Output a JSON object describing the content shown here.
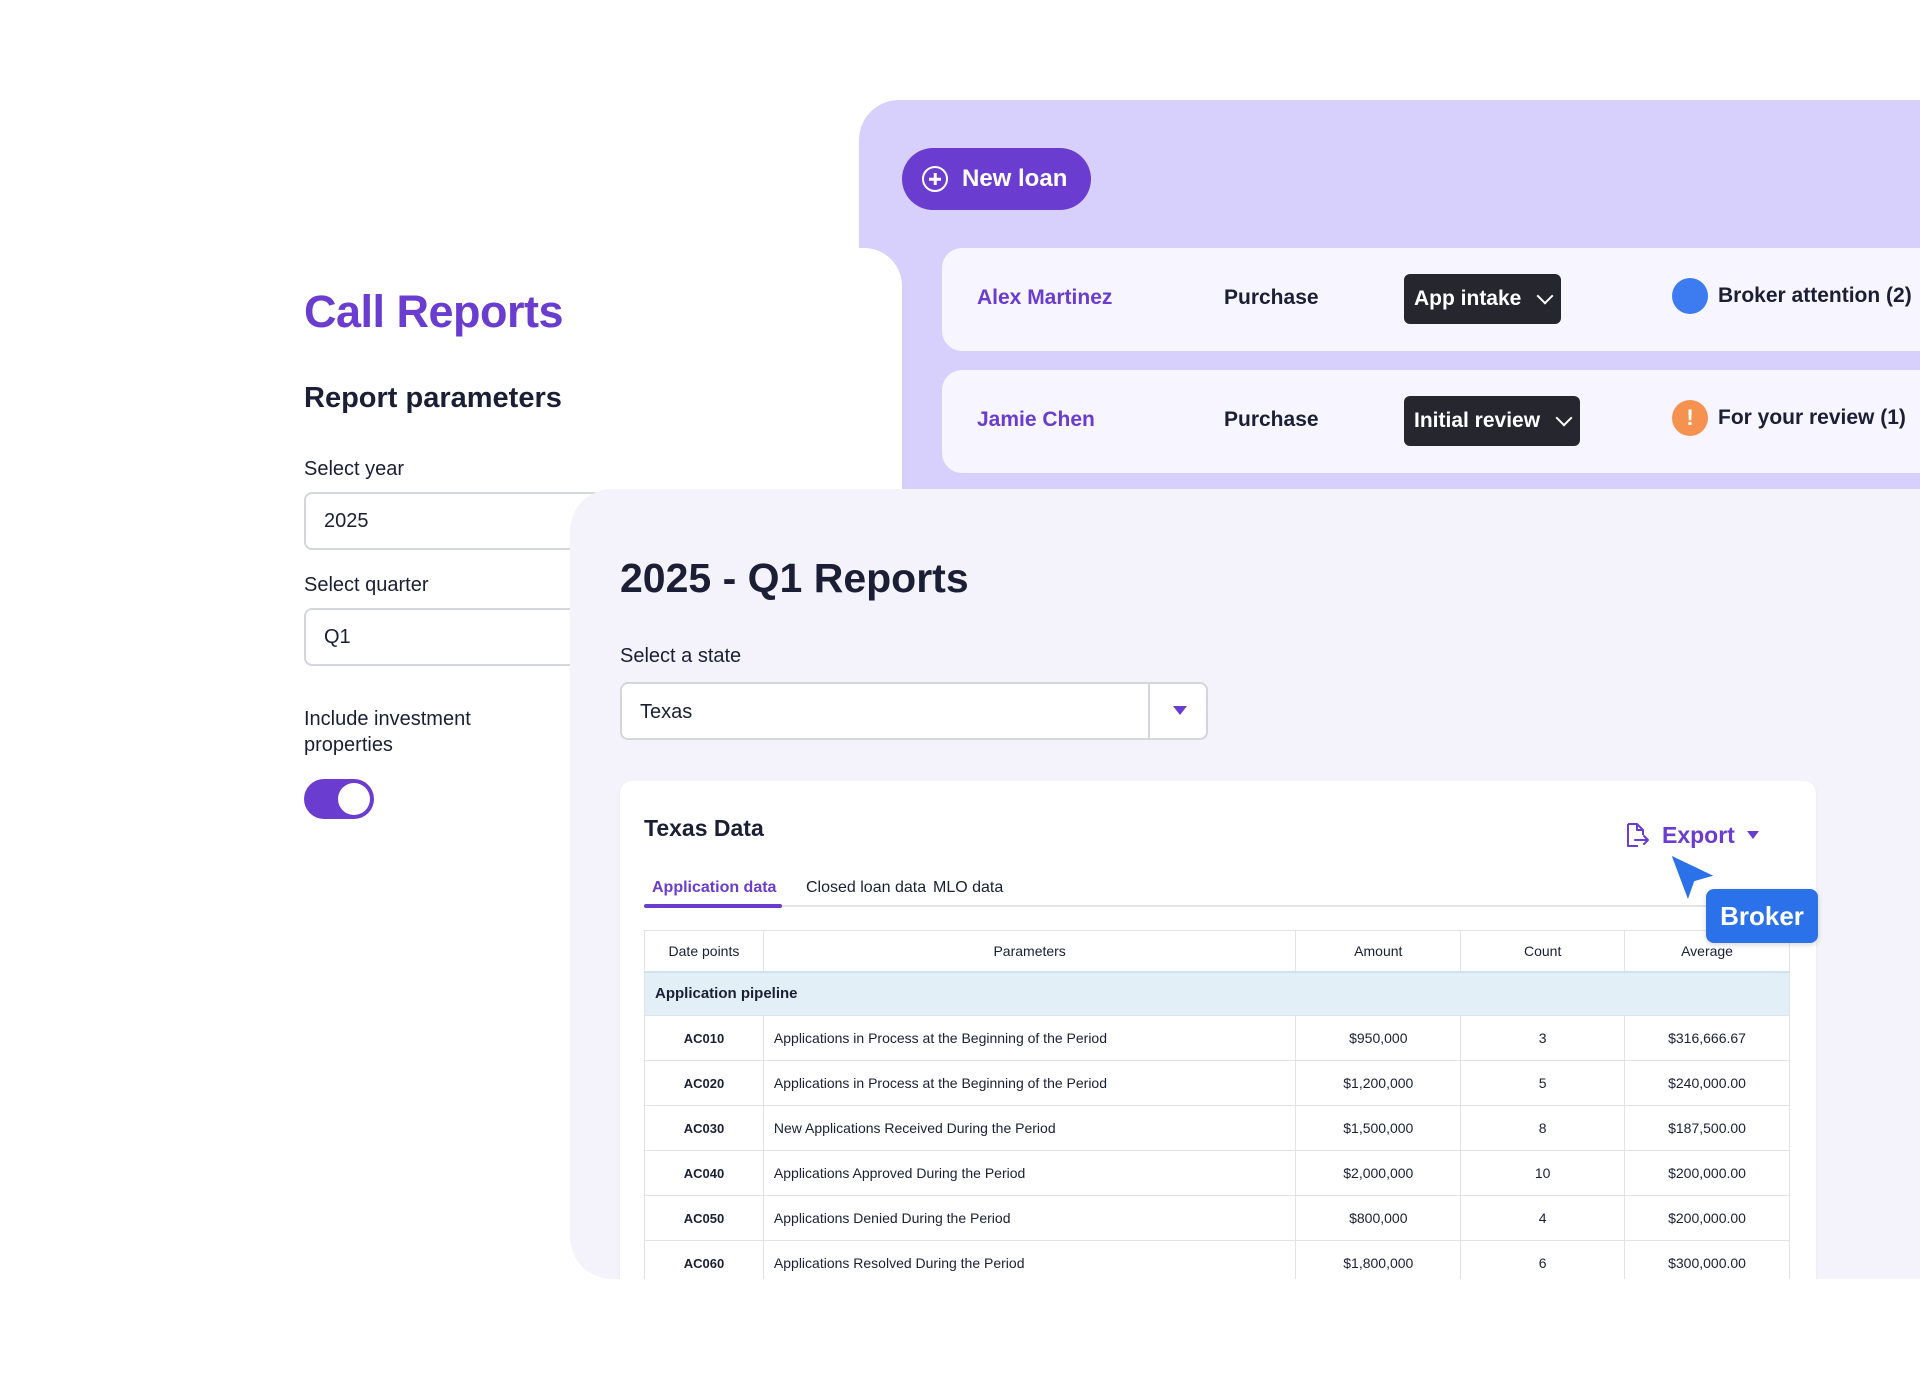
{
  "call_reports": {
    "title": "Call Reports",
    "section_title": "Report parameters",
    "year_label": "Select year",
    "year_value": "2025",
    "quarter_label": "Select quarter",
    "quarter_value": "Q1",
    "investment_label": "Include investment properties",
    "investment_toggle_on": true
  },
  "pipeline": {
    "new_loan_label": "New loan",
    "loans": [
      {
        "name": "Alex Martinez",
        "type": "Purchase",
        "stage": "App intake",
        "status": "Broker attention (2)",
        "status_color": "#3c7bf0"
      },
      {
        "name": "Jamie Chen",
        "type": "Purchase",
        "stage": "Initial review",
        "status": "For your review (1)",
        "status_color": "#f5924f",
        "status_glyph": "!"
      }
    ]
  },
  "reports": {
    "title": "2025 - Q1 Reports",
    "state_label": "Select a state",
    "state_value": "Texas",
    "data_title": "Texas Data",
    "export_label": "Export",
    "tabs": [
      "Application data",
      "Closed loan data",
      "MLO data"
    ],
    "active_tab": "Application data",
    "columns": [
      "Date points",
      "Parameters",
      "Amount",
      "Count",
      "Average"
    ],
    "group_label": "Application pipeline",
    "rows": [
      {
        "code": "AC010",
        "param": "Applications in Process at the Beginning of the Period",
        "amount": "$950,000",
        "count": "3",
        "average": "$316,666.67"
      },
      {
        "code": "AC020",
        "param": "Applications in Process at the Beginning of the Period",
        "amount": "$1,200,000",
        "count": "5",
        "average": "$240,000.00"
      },
      {
        "code": "AC030",
        "param": "New Applications Received During the Period",
        "amount": "$1,500,000",
        "count": "8",
        "average": "$187,500.00"
      },
      {
        "code": "AC040",
        "param": "Applications Approved During the Period",
        "amount": "$2,000,000",
        "count": "10",
        "average": "$200,000.00"
      },
      {
        "code": "AC050",
        "param": "Applications Denied During the Period",
        "amount": "$800,000",
        "count": "4",
        "average": "$200,000.00"
      },
      {
        "code": "AC060",
        "param": "Applications Resolved During the Period",
        "amount": "$1,800,000",
        "count": "6",
        "average": "$300,000.00"
      }
    ]
  },
  "collaborator": {
    "label": "Broker",
    "color": "#2b71ea"
  },
  "colors": {
    "accent": "#6a3cd0",
    "panel_lavender": "#d7cffc",
    "dark_chip": "#25262e"
  }
}
